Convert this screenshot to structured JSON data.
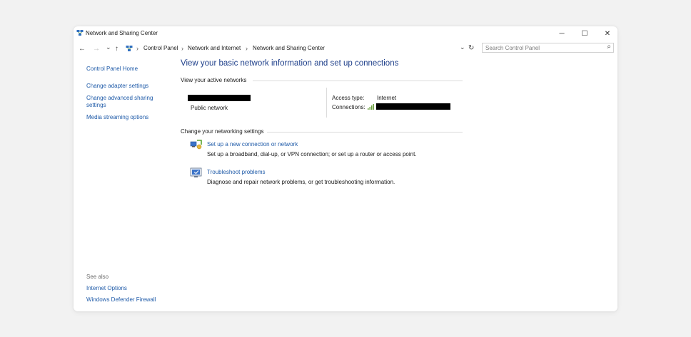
{
  "window": {
    "title": "Network and Sharing Center",
    "controls": {
      "minimize": "─",
      "maximize": "☐",
      "close": "✕"
    }
  },
  "nav": {
    "back": "←",
    "forward": "→",
    "recent": "⌄",
    "up": "↑",
    "breadcrumb": [
      "Control Panel",
      "Network and Internet",
      "Network and Sharing Center"
    ],
    "separator": "›",
    "dropdown": "⌄",
    "refresh": "↻"
  },
  "search": {
    "placeholder": "Search Control Panel",
    "value": "",
    "icon": "⌕"
  },
  "sidebar": {
    "home": "Control Panel Home",
    "items": [
      "Change adapter settings",
      "Change advanced sharing",
      "settings",
      "Media streaming options"
    ],
    "see_also_label": "See also",
    "see_also": [
      "Internet Options",
      "Windows Defender Firewall"
    ]
  },
  "main": {
    "heading": "View your basic network information and set up connections",
    "active_networks_label": "View your active networks",
    "network": {
      "type": "Public network",
      "access_type_label": "Access type:",
      "access_type_value": "Internet",
      "connections_label": "Connections:"
    },
    "change_settings_label": "Change your networking settings",
    "tasks": [
      {
        "title": "Set up a new connection or network",
        "description": "Set up a broadband, dial-up, or VPN connection; or set up a router or access point.",
        "icon": "network-setup-icon"
      },
      {
        "title": "Troubleshoot problems",
        "description": "Diagnose and repair network problems, or get troubleshooting information.",
        "icon": "troubleshoot-icon"
      }
    ]
  },
  "colors": {
    "link": "#1e5aa8",
    "heading": "#1e3f8a",
    "background": "#f2f2f2",
    "window": "#ffffff",
    "redaction": "#000000"
  }
}
